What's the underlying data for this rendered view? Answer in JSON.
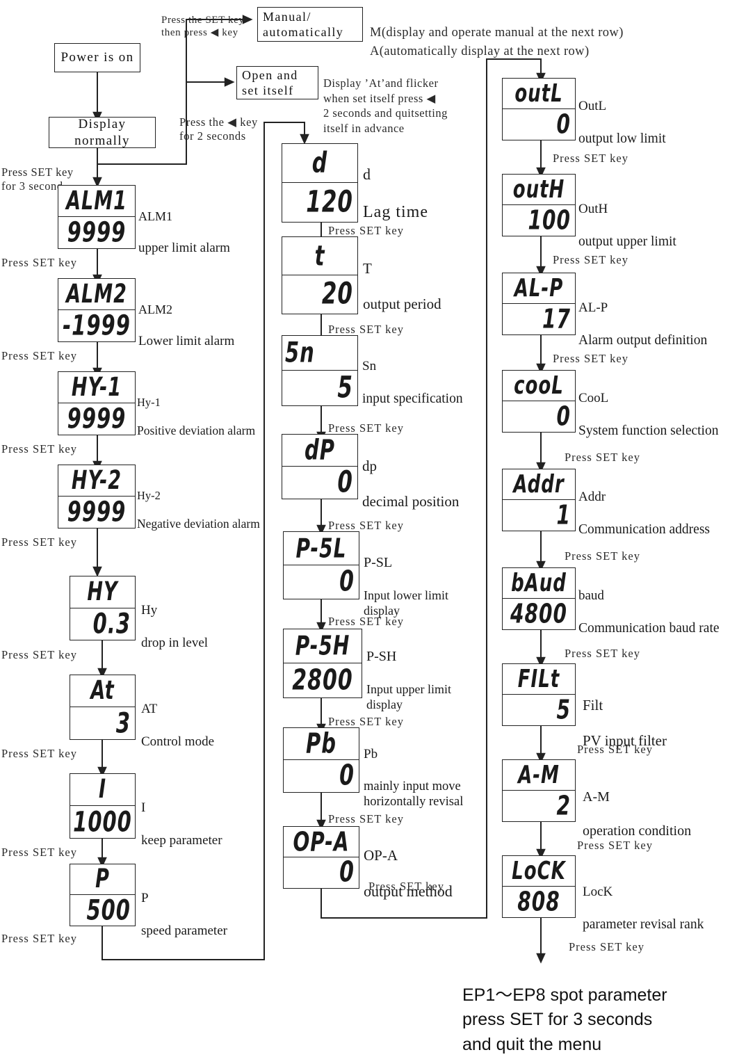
{
  "flow_boxes": {
    "power": "Power is on",
    "display_normally": "Display normally",
    "manual_auto": "Manual/\nautomatically",
    "open_set": "Open and\nset itself"
  },
  "notes": {
    "press_set_then_left": "Press the SET key\nthen press ◀ key",
    "manual_auto_desc": "M(display and operate manual at the next row)\nA(automatically display at the next row)",
    "open_set_desc": "Display ’At’and flicker\nwhen set itself press ◀\n2 seconds and quitsetting\nitself in advance",
    "press_left_2s": "Press the ◀ key\nfor 2 seconds",
    "press_set_3s": "Press SET key\nfor 3 second",
    "set_key": "Press SET key",
    "footer": "EP1～EP8 spot parameter\npress SET for 3 seconds\nand quit the menu",
    "footer_prefix": "EP1～"
  },
  "columns": {
    "left": [
      {
        "seg_label": "ALM1",
        "seg_value": "9999",
        "code": "ALM1",
        "desc": "upper limit alarm",
        "label_align": "center",
        "value_align": "fill"
      },
      {
        "seg_label": "ALM2",
        "seg_value": "-1999",
        "code": "ALM2",
        "desc": "Lower limit alarm",
        "label_align": "center",
        "value_align": "fill"
      },
      {
        "seg_label": "HY-1",
        "seg_value": "9999",
        "code": "Hy-1",
        "desc": "Positive deviation alarm",
        "label_align": "center",
        "value_align": "fill"
      },
      {
        "seg_label": "HY-2",
        "seg_value": "9999",
        "code": "Hy-2",
        "desc": "Negative deviation alarm",
        "label_align": "center",
        "value_align": "fill"
      },
      {
        "seg_label": "HY",
        "seg_value": "0.3",
        "code": "Hy",
        "desc": "drop in level",
        "label_align": "center",
        "value_align": "right"
      },
      {
        "seg_label": "At",
        "seg_value": "3",
        "code": "AT",
        "desc": "Control mode",
        "label_align": "center",
        "value_align": "right"
      },
      {
        "seg_label": "I",
        "seg_value": "1000",
        "code": "I",
        "desc": "keep parameter",
        "label_align": "center",
        "value_align": "fill"
      },
      {
        "seg_label": "P",
        "seg_value": "500",
        "code": "P",
        "desc": "speed parameter",
        "label_align": "center",
        "value_align": "right"
      }
    ],
    "middle": [
      {
        "seg_label": "d",
        "seg_value": "120",
        "code": "d",
        "desc": "Lag time",
        "label_align": "center",
        "value_align": "right"
      },
      {
        "seg_label": "t",
        "seg_value": "20",
        "code": "T",
        "desc": "output period",
        "label_align": "center",
        "value_align": "right"
      },
      {
        "seg_label": "5n",
        "seg_value": "5",
        "code": "Sn",
        "desc": "input specification",
        "label_align": "left",
        "value_align": "right"
      },
      {
        "seg_label": "dP",
        "seg_value": "0",
        "code": "dp",
        "desc": "decimal position",
        "label_align": "center",
        "value_align": "right"
      },
      {
        "seg_label": "P-5L",
        "seg_value": "0",
        "code": "P-SL",
        "desc": "Input lower limit\ndisplay",
        "label_align": "fill",
        "value_align": "right"
      },
      {
        "seg_label": "P-5H",
        "seg_value": "2800",
        "code": "P-SH",
        "desc": "Input upper limit\n display",
        "label_align": "fill",
        "value_align": "fill"
      },
      {
        "seg_label": "Pb",
        "seg_value": "0",
        "code": "Pb",
        "desc": "mainly input move\nhorizontally revisal",
        "label_align": "center",
        "value_align": "right"
      },
      {
        "seg_label": "OP-A",
        "seg_value": "0",
        "code": "OP-A",
        "desc": "output method",
        "label_align": "fill",
        "value_align": "right"
      }
    ],
    "right": [
      {
        "seg_label": "outL",
        "seg_value": "0",
        "code": "OutL",
        "desc": "output low limit",
        "label_align": "fill",
        "value_align": "right"
      },
      {
        "seg_label": "outH",
        "seg_value": "100",
        "code": "OutH",
        "desc": "output upper limit",
        "label_align": "fill",
        "value_align": "right"
      },
      {
        "seg_label": "AL-P",
        "seg_value": "17",
        "code": "AL-P",
        "desc": "Alarm output definition",
        "label_align": "fill",
        "value_align": "right"
      },
      {
        "seg_label": "cooL",
        "seg_value": "0",
        "code": "CooL",
        "desc": "System function selection",
        "label_align": "fill",
        "value_align": "right"
      },
      {
        "seg_label": "Addr",
        "seg_value": "1",
        "code": "Addr",
        "desc": "Communication address",
        "label_align": "fill",
        "value_align": "right"
      },
      {
        "seg_label": "bAud",
        "seg_value": "4800",
        "code": "baud",
        "desc": "Communication baud rate",
        "label_align": "fill",
        "value_align": "fill"
      },
      {
        "seg_label": "FILt",
        "seg_value": "5",
        "code": "Filt",
        "desc": "PV input filter",
        "label_align": "fill",
        "value_align": "right"
      },
      {
        "seg_label": "A-M",
        "seg_value": "2",
        "code": "A-M",
        "desc": "operation condition",
        "label_align": "fill",
        "value_align": "right"
      },
      {
        "seg_label": "LoCK",
        "seg_value": "808",
        "code": "LocK",
        "desc": "parameter revisal rank",
        "label_align": "fill",
        "value_align": "fill"
      }
    ]
  },
  "colors": {
    "line": "#222222",
    "text": "#1a1a1a",
    "background": "#ffffff"
  }
}
